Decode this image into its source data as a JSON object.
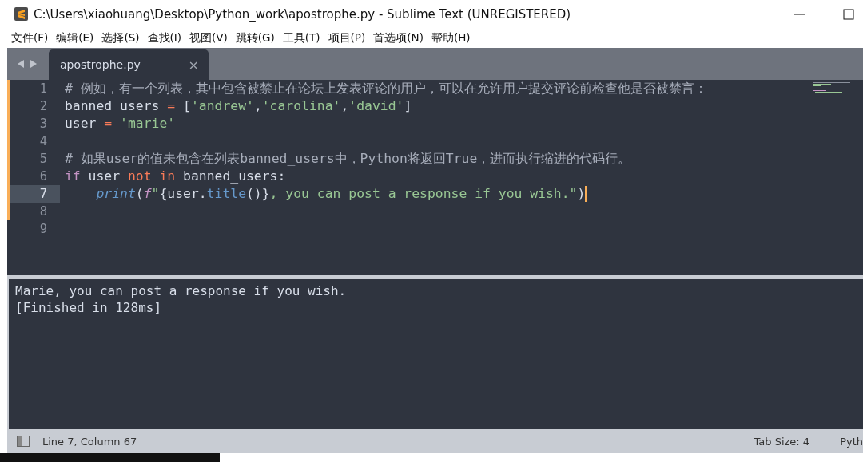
{
  "window": {
    "title": "C:\\Users\\xiaohuang\\Desktop\\Python_work\\apostrophe.py - Sublime Text (UNREGISTERED)"
  },
  "menu": [
    "文件(F)",
    "编辑(E)",
    "选择(S)",
    "查找(I)",
    "视图(V)",
    "跳转(G)",
    "工具(T)",
    "项目(P)",
    "首选项(N)",
    "帮助(H)"
  ],
  "tabs": [
    {
      "label": "apostrophe.py",
      "close": "×",
      "selected": true
    }
  ],
  "editor": {
    "lines": [
      {
        "number": "1",
        "modified": true,
        "current": false,
        "tokens": [
          {
            "kind": "comment",
            "text": "# 例如，有一个列表，其中包含被禁止在论坛上发表评论的用户，可以在允许用户提交评论前检查他是否被禁言："
          }
        ]
      },
      {
        "number": "2",
        "modified": true,
        "current": false,
        "tokens": [
          {
            "kind": "plain",
            "text": "banned_users "
          },
          {
            "kind": "operator",
            "text": "="
          },
          {
            "kind": "plain",
            "text": " ["
          },
          {
            "kind": "string",
            "text": "'andrew'"
          },
          {
            "kind": "plain",
            "text": ","
          },
          {
            "kind": "string",
            "text": "'carolina'"
          },
          {
            "kind": "plain",
            "text": ","
          },
          {
            "kind": "string",
            "text": "'david'"
          },
          {
            "kind": "plain",
            "text": "]"
          }
        ]
      },
      {
        "number": "3",
        "modified": true,
        "current": false,
        "tokens": [
          {
            "kind": "plain",
            "text": "user "
          },
          {
            "kind": "operator",
            "text": "="
          },
          {
            "kind": "string",
            "text": " 'marie'"
          }
        ]
      },
      {
        "number": "4",
        "modified": true,
        "current": false
      },
      {
        "number": "5",
        "modified": true,
        "current": false,
        "tokens": [
          {
            "kind": "comment",
            "text": "# 如果user的值未包含在列表banned_users中，Python将返回True，进而执行缩进的代码行。"
          }
        ]
      },
      {
        "number": "6",
        "modified": true,
        "current": false,
        "tokens": [
          {
            "kind": "keyword",
            "text": "if"
          },
          {
            "kind": "plain",
            "text": " user "
          },
          {
            "kind": "operator",
            "text": "not in"
          },
          {
            "kind": "plain",
            "text": " banned_users:"
          }
        ]
      },
      {
        "number": "7",
        "modified": true,
        "current": true,
        "tokens": [
          {
            "kind": "function",
            "text": "    print"
          },
          {
            "kind": "plain",
            "text": "("
          },
          {
            "kind": "prefix",
            "text": "f"
          },
          {
            "kind": "string",
            "text": "\""
          },
          {
            "kind": "plain",
            "text": "{user."
          },
          {
            "kind": "method",
            "text": "title"
          },
          {
            "kind": "plain",
            "text": "()}"
          },
          {
            "kind": "string",
            "text": ", you can post a response if you wish.\""
          },
          {
            "kind": "plain",
            "text": ")"
          }
        ]
      },
      {
        "number": "8",
        "modified": true,
        "current": false
      },
      {
        "number": "9",
        "modified": false,
        "current": false
      }
    ]
  },
  "output": [
    "Marie, you can post a response if you wish.",
    "[Finished in 128ms]"
  ],
  "status_bar": {
    "position": "Line 7, Column 67",
    "tab_size": "Tab Size: 4",
    "syntax": "Pyth"
  }
}
